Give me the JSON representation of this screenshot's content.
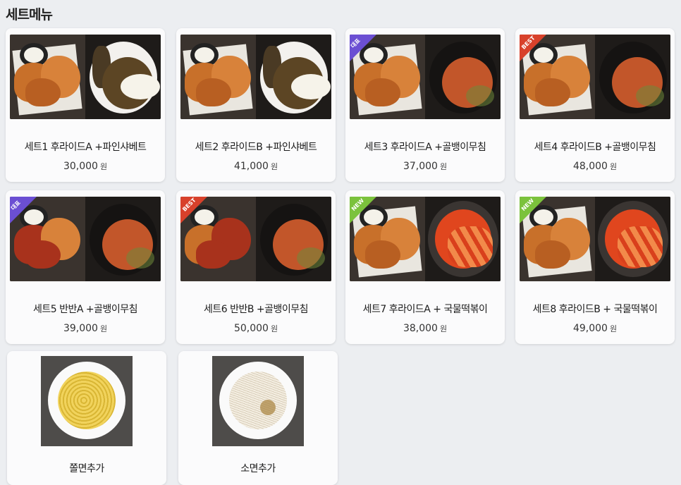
{
  "section_title": "세트메뉴",
  "currency": "원",
  "sets": [
    {
      "name": "세트1 후라이드A +파인샤베트",
      "price": "30,000",
      "badge": ""
    },
    {
      "name": "세트2 후라이드B +파인샤베트",
      "price": "41,000",
      "badge": ""
    },
    {
      "name": "세트3 후라이드A +골뱅이무침",
      "price": "37,000",
      "badge": "대표"
    },
    {
      "name": "세트4 후라이드B +골뱅이무침",
      "price": "48,000",
      "badge": "BEST"
    },
    {
      "name": "세트5 반반A +골뱅이무침",
      "price": "39,000",
      "badge": "대표"
    },
    {
      "name": "세트6 반반B +골뱅이무침",
      "price": "50,000",
      "badge": "BEST"
    },
    {
      "name": "세트7 후라이드A + 국물떡볶이",
      "price": "38,000",
      "badge": "NEW"
    },
    {
      "name": "세트8 후라이드B + 국물떡볶이",
      "price": "49,000",
      "badge": "NEW"
    }
  ],
  "sides": [
    {
      "name": "쫄면추가"
    },
    {
      "name": "소면추가"
    }
  ],
  "colors": {
    "badge_daepyo": "#6b4fd3",
    "badge_best": "#d8412b",
    "badge_new": "#7bc23c"
  }
}
